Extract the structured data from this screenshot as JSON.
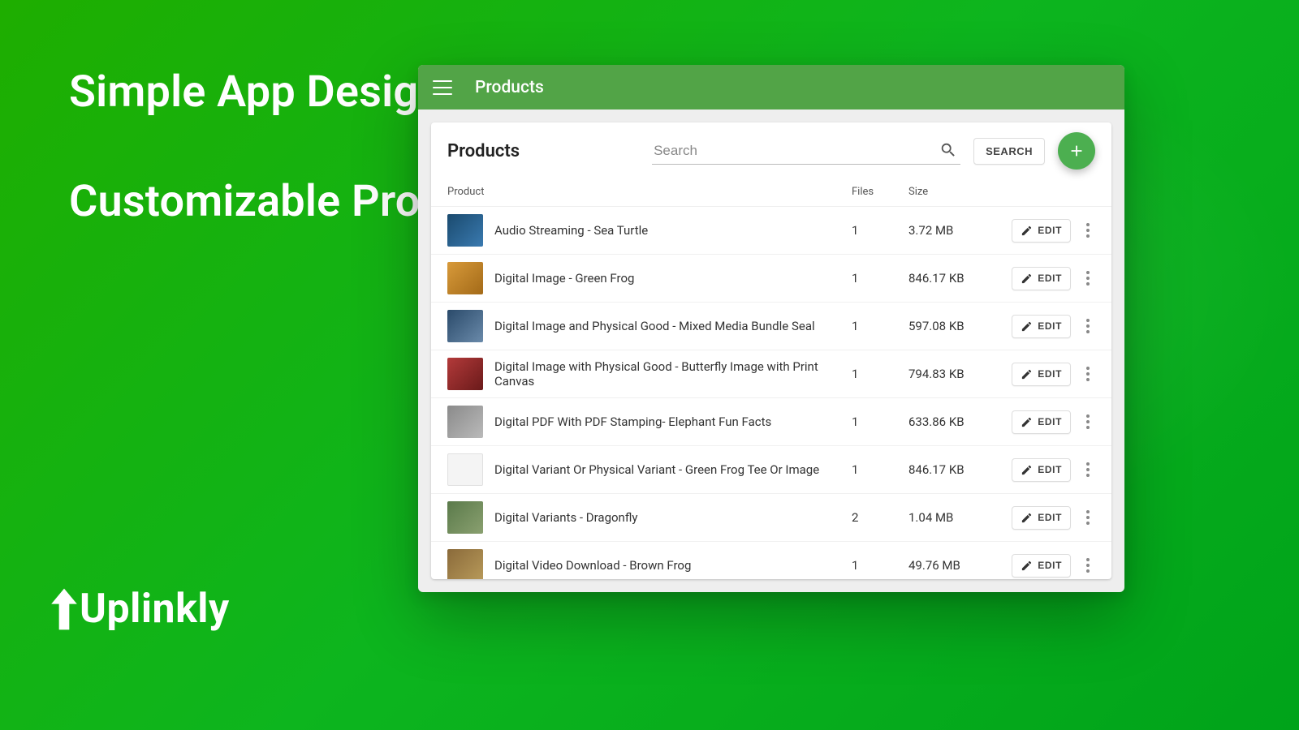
{
  "promo": {
    "headline1": "Simple App Design, Easily Add & Edit",
    "headline2": "Customizable Product Settings",
    "brand": "Uplinkly"
  },
  "appbar": {
    "title": "Products"
  },
  "card": {
    "title": "Products",
    "search_placeholder": "Search",
    "search_btn": "SEARCH"
  },
  "columns": {
    "product": "Product",
    "files": "Files",
    "size": "Size"
  },
  "edit_label": "EDIT",
  "products": [
    {
      "name": "Audio Streaming - Sea Turtle",
      "files": "1",
      "size": "3.72 MB"
    },
    {
      "name": "Digital Image - Green Frog",
      "files": "1",
      "size": "846.17 KB"
    },
    {
      "name": "Digital Image and Physical Good - Mixed Media Bundle Seal",
      "files": "1",
      "size": "597.08 KB"
    },
    {
      "name": "Digital Image with Physical Good - Butterfly Image with Print Canvas",
      "files": "1",
      "size": "794.83 KB"
    },
    {
      "name": "Digital PDF With PDF Stamping- Elephant Fun Facts",
      "files": "1",
      "size": "633.86 KB"
    },
    {
      "name": "Digital Variant Or Physical Variant - Green Frog Tee Or Image",
      "files": "1",
      "size": "846.17 KB"
    },
    {
      "name": "Digital Variants - Dragonfly",
      "files": "2",
      "size": "1.04 MB"
    },
    {
      "name": "Digital Video Download - Brown Frog",
      "files": "1",
      "size": "49.76 MB"
    }
  ]
}
